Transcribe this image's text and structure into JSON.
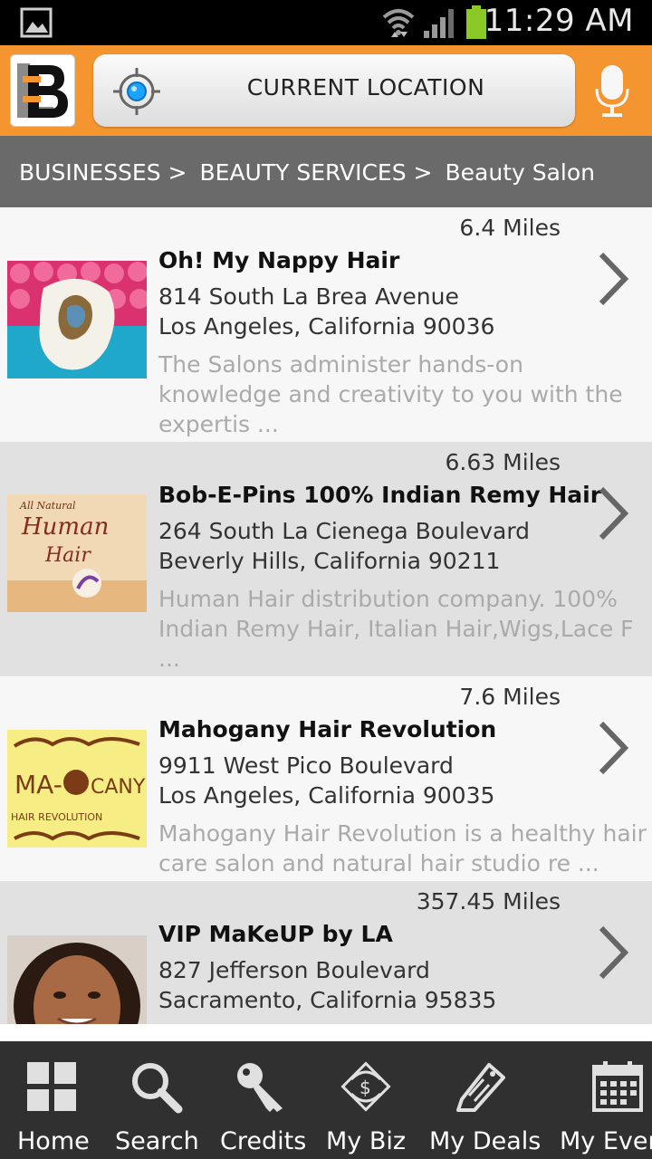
{
  "status_bar": {
    "time": "11:29 AM",
    "icons": [
      "gallery-icon",
      "wifi-icon",
      "signal-icon",
      "battery-icon"
    ]
  },
  "header": {
    "logo_letter": "B",
    "location_label": "CURRENT LOCATION",
    "icons": [
      "logo-icon",
      "crosshair-icon",
      "microphone-icon"
    ]
  },
  "breadcrumb": {
    "items": [
      "BUSINESSES >",
      "BEAUTY SERVICES >",
      "Beauty Salon"
    ]
  },
  "listings": [
    {
      "distance": "6.4 Miles",
      "name": "Oh! My Nappy Hair",
      "address1": "814 South La Brea Avenue",
      "address2": "Los Angeles, California 90036",
      "description": "The Salons administer hands-on knowledge and creativity to you with the expertis ..."
    },
    {
      "distance": "6.63 Miles",
      "name": "Bob-E-Pins 100% Indian Remy Hair",
      "address1": "264 South La Cienega Boulevard",
      "address2": "Beverly Hills, California 90211",
      "description": "Human Hair distribution company. 100% Indian Remy Hair, Italian Hair,Wigs,Lace F ...",
      "thumb_text": [
        "All Natural",
        "Human",
        "Hair"
      ]
    },
    {
      "distance": "7.6 Miles",
      "name": "Mahogany Hair Revolution",
      "address1": "9911 West Pico Boulevard",
      "address2": "Los Angeles, California 90035",
      "description": "Mahogany Hair Revolution is a healthy hair care salon and natural hair studio re ...",
      "thumb_text": [
        "MA-",
        "CANY",
        "HAIR REVOLUTION"
      ]
    },
    {
      "distance": "357.45 Miles",
      "name": "VIP MaKeUP by LA",
      "address1": "827 Jefferson Boulevard",
      "address2": "Sacramento, California 95835",
      "description": ""
    }
  ],
  "nav": {
    "items": [
      {
        "label": "Home",
        "icon": "grid-icon"
      },
      {
        "label": "Search",
        "icon": "magnifier-icon"
      },
      {
        "label": "Credits",
        "icon": "key-icon"
      },
      {
        "label": "My Biz",
        "icon": "dollar-tag-icon"
      },
      {
        "label": "My Deals",
        "icon": "tag-icon"
      },
      {
        "label": "My Even",
        "icon": "calendar-icon"
      }
    ]
  },
  "colors": {
    "header": "#f4952f",
    "breadcrumb": "#6a6a6a",
    "row_light": "#f7f7f7",
    "row_dark": "#e1e1e1",
    "nav": "#303030",
    "battery": "#8ac926"
  }
}
